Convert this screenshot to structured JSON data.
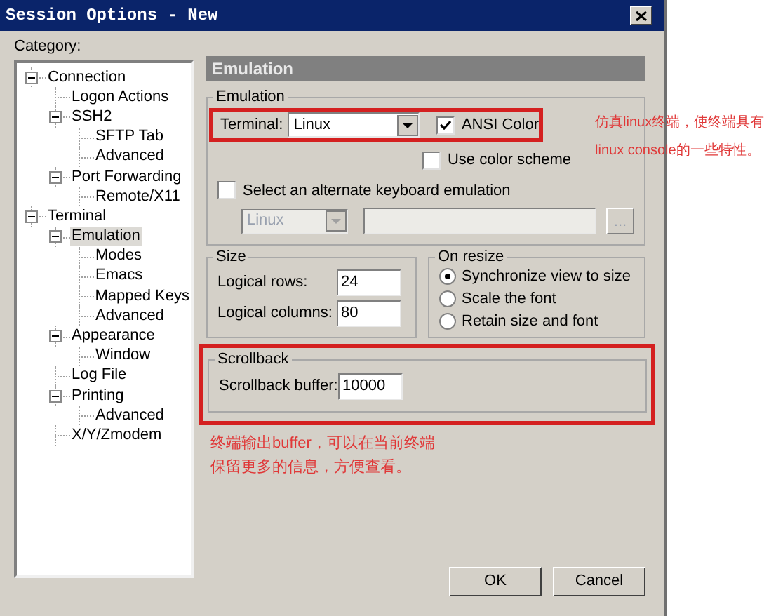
{
  "window": {
    "title": "Session Options - New"
  },
  "category_label": "Category:",
  "tree": [
    {
      "label": "Connection",
      "selected": false,
      "expanded": true,
      "children": [
        {
          "label": "Logon Actions",
          "selected": false
        },
        {
          "label": "SSH2",
          "selected": false,
          "expanded": true,
          "children": [
            {
              "label": "SFTP Tab",
              "selected": false
            },
            {
              "label": "Advanced",
              "selected": false
            }
          ]
        },
        {
          "label": "Port Forwarding",
          "selected": false,
          "expanded": true,
          "children": [
            {
              "label": "Remote/X11",
              "selected": false
            }
          ]
        }
      ]
    },
    {
      "label": "Terminal",
      "selected": false,
      "expanded": true,
      "children": [
        {
          "label": "Emulation",
          "selected": true,
          "expanded": true,
          "children": [
            {
              "label": "Modes",
              "selected": false
            },
            {
              "label": "Emacs",
              "selected": false
            },
            {
              "label": "Mapped Keys",
              "selected": false
            },
            {
              "label": "Advanced",
              "selected": false
            }
          ]
        },
        {
          "label": "Appearance",
          "selected": false,
          "expanded": true,
          "children": [
            {
              "label": "Window",
              "selected": false
            }
          ]
        },
        {
          "label": "Log File",
          "selected": false
        },
        {
          "label": "Printing",
          "selected": false,
          "expanded": true,
          "children": [
            {
              "label": "Advanced",
              "selected": false
            }
          ]
        },
        {
          "label": "X/Y/Zmodem",
          "selected": false
        }
      ]
    }
  ],
  "panel_header": "Emulation",
  "emulation": {
    "title": "Emulation",
    "terminal_label": "Terminal:",
    "terminal_value": "Linux",
    "ansi_color": {
      "label": "ANSI Color",
      "checked": true
    },
    "use_color_scheme": {
      "label": "Use color scheme",
      "checked": false
    },
    "alternate_keyboard": {
      "label": "Select an alternate keyboard emulation",
      "checked": false
    },
    "alternate_value": "Linux",
    "browse_button": "..."
  },
  "size": {
    "title": "Size",
    "rows_label": "Logical rows:",
    "rows_value": "24",
    "columns_label": "Logical columns:",
    "columns_value": "80"
  },
  "on_resize": {
    "title": "On resize",
    "options": [
      {
        "label": "Synchronize view to size",
        "selected": true
      },
      {
        "label": "Scale the font",
        "selected": false
      },
      {
        "label": "Retain size and font",
        "selected": false
      }
    ]
  },
  "scrollback": {
    "title": "Scrollback",
    "label": "Scrollback buffer:",
    "value": "10000"
  },
  "annotations": [
    {
      "lines": [
        "仿真linux终端，使终端具有",
        "linux console的一些特性。"
      ]
    },
    {
      "lines": [
        "终端输出buffer，可以在当前终端",
        "保留更多的信息，方便查看。"
      ]
    }
  ],
  "buttons": [
    "OK",
    "Cancel"
  ]
}
